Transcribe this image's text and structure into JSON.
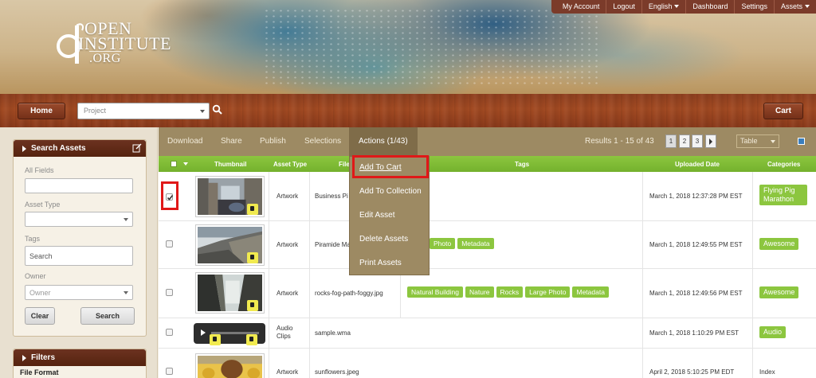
{
  "topbar": {
    "items": [
      "My Account",
      "Logout",
      "English",
      "Dashboard",
      "Settings",
      "Assets"
    ]
  },
  "logo": {
    "line1": "OPEN",
    "line2": "INSTITUTE",
    "line3": ".ORG"
  },
  "nav": {
    "home_label": "Home",
    "project_placeholder": "Project",
    "cart_label": "Cart"
  },
  "sidebar": {
    "search_title": "Search Assets",
    "all_fields_label": "All Fields",
    "all_fields_value": "",
    "asset_type_label": "Asset Type",
    "asset_type_value": "",
    "tags_label": "Tags",
    "tags_placeholder": "Search",
    "owner_label": "Owner",
    "owner_placeholder": "Owner",
    "clear_label": "Clear",
    "search_label": "Search",
    "filters_title": "Filters",
    "filter_first": "File Format"
  },
  "toolbar": {
    "download": "Download",
    "share": "Share",
    "publish": "Publish",
    "selections": "Selections",
    "actions": "Actions (1/43)",
    "results": "Results 1 - 15 of 43",
    "pages": [
      "1",
      "2",
      "3"
    ],
    "view": "Table"
  },
  "table": {
    "headers": {
      "thumbnail": "Thumbnail",
      "asset_type": "Asset Type",
      "file": "File",
      "tags": "Tags",
      "uploaded": "Uploaded Date",
      "categories": "Categories"
    },
    "rows": [
      {
        "checked": true,
        "type": "Artwork",
        "file": "Business Pi",
        "tags": [],
        "date": "March 1, 2018 12:37:28 PM EST",
        "category": "Flying Pig Marathon"
      },
      {
        "checked": false,
        "type": "Artwork",
        "file": "Piramide Ma",
        "tags": [
          "Photo",
          "Metadata"
        ],
        "date": "March 1, 2018 12:49:55 PM EST",
        "category": "Awesome"
      },
      {
        "checked": false,
        "type": "Artwork",
        "file": "rocks-fog-path-foggy.jpg",
        "tags": [
          "Natural Building",
          "Nature",
          "Rocks",
          "Large Photo",
          "Metadata"
        ],
        "date": "March 1, 2018 12:49:56 PM EST",
        "category": "Awesome"
      },
      {
        "checked": false,
        "type": "Audio Clips",
        "file": "sample.wma",
        "tags": [],
        "date": "March 1, 2018 1:10:29 PM EST",
        "category": "Audio"
      },
      {
        "checked": false,
        "type": "Artwork",
        "file": "sunflowers.jpeg",
        "tags": [],
        "date": "April 2, 2018 5:10:25 PM EDT",
        "category": "Index"
      }
    ]
  },
  "actions_menu": {
    "items": [
      "Add To Cart",
      "Add To Collection",
      "Edit Asset",
      "Delete Assets",
      "Print Assets"
    ]
  },
  "colors": {
    "accent_green": "#8cc63f",
    "toolbar_tan": "#9d8a63",
    "wood_brown": "#a24a22",
    "highlight_red": "#e01818"
  }
}
